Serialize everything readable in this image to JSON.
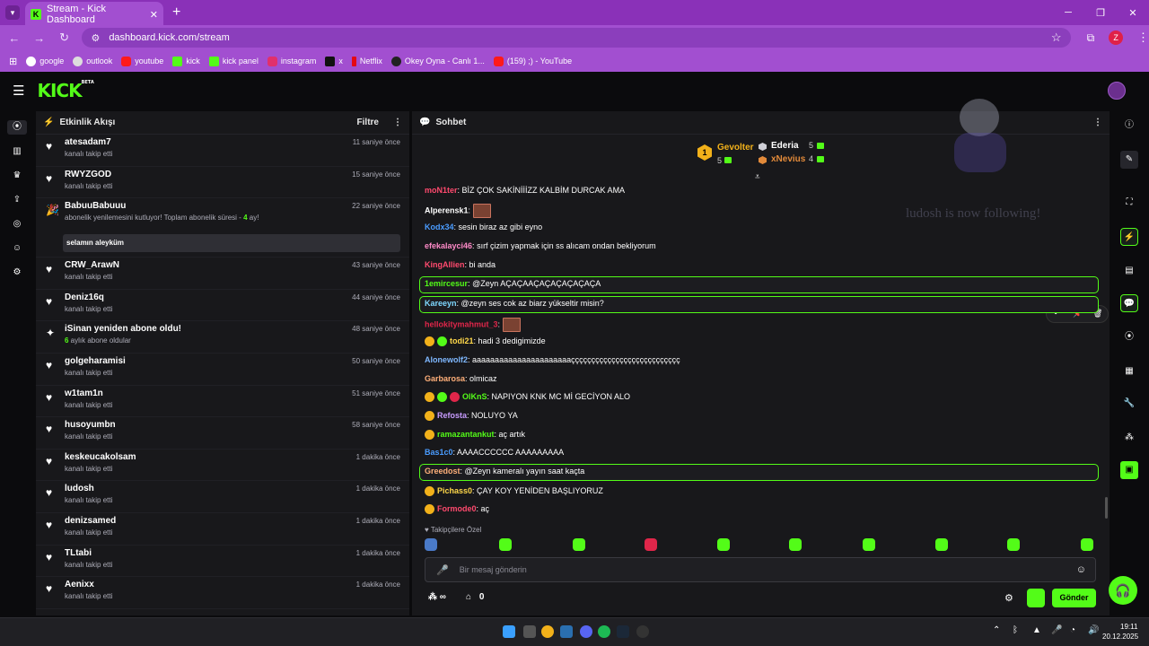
{
  "browser": {
    "tab_title": "Stream - Kick Dashboard",
    "url": "dashboard.kick.com/stream",
    "profile_initial": "Z",
    "bookmarks": [
      "google",
      "outlook",
      "youtube",
      "kick",
      "kick panel",
      "instagram",
      "x",
      "Netflix",
      "Okey Oyna - Canlı 1...",
      "(159) ;) - YouTube"
    ]
  },
  "colors": {
    "accent": "#53fc18",
    "browser": "#a24fd0"
  },
  "activity": {
    "title": "Etkinlik Akışı",
    "filter": "Filtre",
    "events": [
      {
        "name": "atesadam7",
        "sub": "kanalı takip etti",
        "time": "11 saniye önce"
      },
      {
        "name": "RWYZGOD",
        "sub": "kanalı takip etti",
        "time": "15 saniye önce"
      },
      {
        "name": "BabuuBabuuu",
        "sub_a": "abonelik yenilemesini kutluyor! Toplam abonelik süresi - ",
        "sub_num": "4",
        "sub_b": " ay!",
        "time": "22 saniye önce",
        "message": "selamın aleyküm"
      },
      {
        "name": "CRW_ArawN",
        "sub": "kanalı takip etti",
        "time": "43 saniye önce"
      },
      {
        "name": "Deniz16q",
        "sub": "kanalı takip etti",
        "time": "44 saniye önce"
      },
      {
        "name": "iSinan yeniden abone oldu!",
        "sub_num": "6",
        "sub_b": " aylık abone oldular",
        "time": "48 saniye önce"
      },
      {
        "name": "golgeharamisi",
        "sub": "kanalı takip etti",
        "time": "50 saniye önce"
      },
      {
        "name": "w1tam1n",
        "sub": "kanalı takip etti",
        "time": "51 saniye önce"
      },
      {
        "name": "husoyumbn",
        "sub": "kanalı takip etti",
        "time": "58 saniye önce"
      },
      {
        "name": "keskeucakolsam",
        "sub": "kanalı takip etti",
        "time": "1 dakika önce"
      },
      {
        "name": "ludosh",
        "sub": "kanalı takip etti",
        "time": "1 dakika önce"
      },
      {
        "name": "denizsamed",
        "sub": "kanalı takip etti",
        "time": "1 dakika önce"
      },
      {
        "name": "TLtabi",
        "sub": "kanalı takip etti",
        "time": "1 dakika önce"
      },
      {
        "name": "Aenixx",
        "sub": "kanalı takip etti",
        "time": "1 dakika önce"
      }
    ]
  },
  "chat": {
    "title": "Sohbet",
    "leaderboard": [
      {
        "rank": "1",
        "name": "Gevolter",
        "count": "5"
      },
      {
        "name": "Ederia",
        "count": "5"
      },
      {
        "name": "xNevius",
        "count": "4"
      }
    ],
    "overlay_text": "ludosh is now following!",
    "messages": [
      {
        "user": "moN1ter",
        "text": "BİZ ÇOK SAKİNİİİZZ KALBİM DURCAK AMA",
        "color": "#ff4a6e"
      },
      {
        "user": "Alperensk1",
        "text": "",
        "color": "#ffffff",
        "emote": true
      },
      {
        "user": "Kodx34",
        "text": "sesin biraz az gibi eyno",
        "color": "#4a9cff"
      },
      {
        "user": "efekalayci46",
        "text": "sırf çizim yapmak için ss alıcam ondan bekliyorum",
        "color": "#ff8ac8"
      },
      {
        "user": "KingAllien",
        "text": "bi anda",
        "color": "#ff4a6e"
      },
      {
        "user": "1emircesur",
        "text": "@Zeyn AÇAÇAAÇAÇAÇAÇAÇAÇA",
        "color": "#53fc18",
        "highlight": true
      },
      {
        "user": "Kareeyn",
        "text": "@zeyn ses cok az biarz yükseltir misin?",
        "color": "#7fd8ff",
        "highlight": true
      },
      {
        "user": "hellokitymahmut_3",
        "text": "",
        "color": "#e0264a",
        "emote": true
      },
      {
        "user": "todi21",
        "text": "hadi 3 dedigimizde",
        "color": "#ffd84a",
        "badges": 2
      },
      {
        "user": "Alonewolf2",
        "text": "aaaaaaaaaaaaaaaaaaaaaaççççççççççççççççççççççççççç",
        "color": "#7fb8ff"
      },
      {
        "user": "Garbarosa",
        "text": "olmicaz",
        "color": "#ffb07a"
      },
      {
        "user": "OlKnS",
        "text": "NAPIYON KNK MC Mİ GECİYON ALO",
        "color": "#53fc18",
        "badges": 3
      },
      {
        "user": "Refosta",
        "text": "NOLUYO YA",
        "color": "#c89cff",
        "badges": 1
      },
      {
        "user": "ramazantankut",
        "text": "aç artık",
        "color": "#53fc18",
        "badges": 1
      },
      {
        "user": "Bas1c0",
        "text": "AAAACCCCCC AAAAAAAAA",
        "color": "#4a9cff"
      },
      {
        "user": "Greedost",
        "text": "@Zeyn kameralı yayın saat kaçta",
        "color": "#ffb07a",
        "highlight": true
      },
      {
        "user": "Pichass0",
        "text": "ÇAY KOY YENİDEN BAŞLIYORUZ",
        "color": "#ffd84a",
        "badges": 1
      },
      {
        "user": "Formode0",
        "text": "aç",
        "color": "#ff4a6e",
        "badges": 1
      }
    ],
    "followers_only": "Takipçilere Özel",
    "placeholder": "Bir mesaj gönderin",
    "infinity": "∞",
    "zero": "0",
    "send": "Gönder"
  },
  "taskbar": {
    "time": "19:11",
    "date": "20.12.2025"
  }
}
